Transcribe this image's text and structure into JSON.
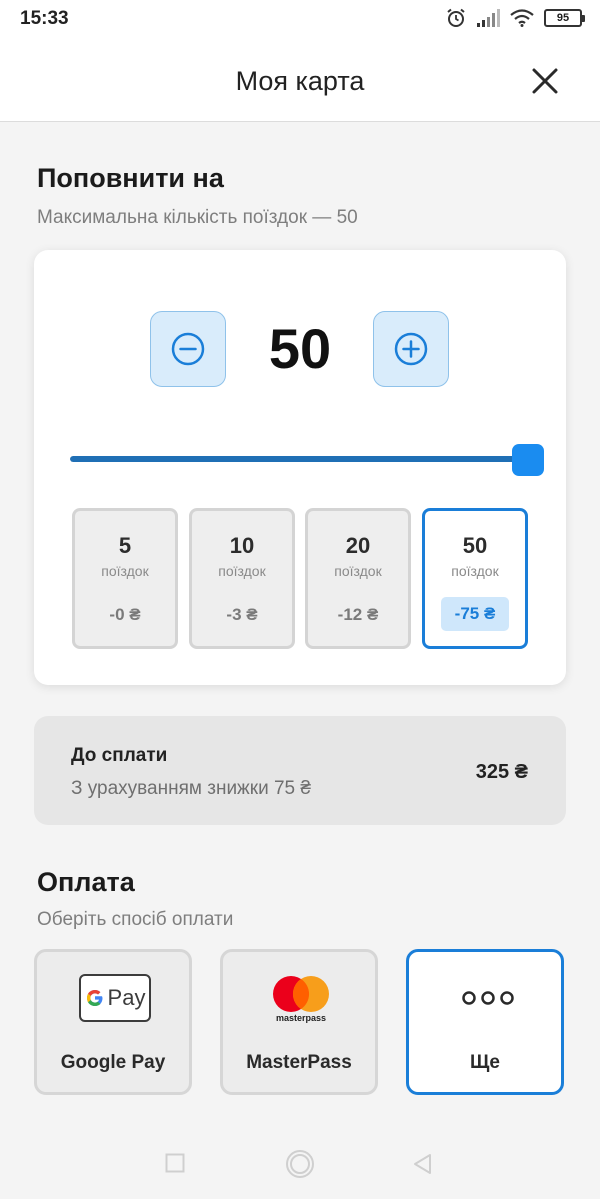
{
  "status_bar": {
    "time": "15:33",
    "battery": "95",
    "icons": [
      "alarm-icon",
      "signal-icon",
      "wifi-icon",
      "battery-icon"
    ]
  },
  "header": {
    "title": "Моя карта",
    "close_icon": "close-icon"
  },
  "topup": {
    "title": "Поповнити на",
    "subtitle": "Максимальна кількість поїздок — 50",
    "count": "50",
    "slider": {
      "value": 50,
      "max": 50,
      "fraction": 1.0
    },
    "options": [
      {
        "count": "5",
        "unit": "поїздок",
        "discount": "-0 ₴",
        "selected": false
      },
      {
        "count": "10",
        "unit": "поїздок",
        "discount": "-3 ₴",
        "selected": false
      },
      {
        "count": "20",
        "unit": "поїздок",
        "discount": "-12 ₴",
        "selected": false
      },
      {
        "count": "50",
        "unit": "поїздок",
        "discount": "-75 ₴",
        "selected": true
      }
    ]
  },
  "total": {
    "label": "До сплати",
    "note": "З урахуванням знижки 75 ₴",
    "amount": "325 ₴"
  },
  "payment": {
    "title": "Оплата",
    "subtitle": "Оберіть спосіб оплати",
    "methods": [
      {
        "label": "Google Pay",
        "logo_text": "Pay",
        "icon": "google-pay-logo",
        "selected": false
      },
      {
        "label": "MasterPass",
        "logo_text": "masterpass",
        "icon": "masterpass-logo",
        "selected": false
      },
      {
        "label": "Ще",
        "icon": "more-dots-icon",
        "selected": true
      }
    ]
  },
  "colors": {
    "accent": "#1a7ed8",
    "slider_fill": "#1f6fb5",
    "stepper_bg": "#d9ecfb",
    "discount_bg": "#cfe7fb"
  },
  "nav_bar": [
    "recent-apps-icon",
    "home-icon",
    "back-icon"
  ]
}
